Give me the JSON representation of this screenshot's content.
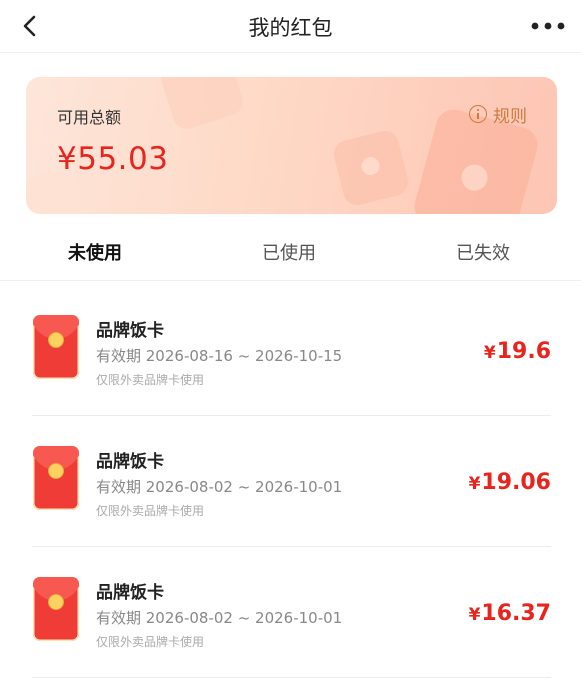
{
  "header": {
    "title": "我的红包"
  },
  "summary": {
    "label": "可用总额",
    "amount": "¥55.03",
    "rules_label": "规则"
  },
  "tabs": [
    {
      "label": "未使用",
      "active": true
    },
    {
      "label": "已使用",
      "active": false
    },
    {
      "label": "已失效",
      "active": false
    }
  ],
  "items": [
    {
      "title": "品牌饭卡",
      "validity": "有效期 2026-08-16 ~ 2026-10-15",
      "note": "仅限外卖品牌卡使用",
      "currency": "¥",
      "amount": "19.6"
    },
    {
      "title": "品牌饭卡",
      "validity": "有效期 2026-08-02 ~ 2026-10-01",
      "note": "仅限外卖品牌卡使用",
      "currency": "¥",
      "amount": "19.06"
    },
    {
      "title": "品牌饭卡",
      "validity": "有效期 2026-08-02 ~ 2026-10-01",
      "note": "仅限外卖品牌卡使用",
      "currency": "¥",
      "amount": "16.37"
    }
  ],
  "icons": {
    "back": "chevron-left-icon",
    "more": "more-horizontal-icon",
    "rules": "info-circle-icon",
    "item": "red-envelope-icon"
  },
  "colors": {
    "accent_red": "#e8241d",
    "rules_orange": "#cf7a3e",
    "banner_peach": "#fed9c6"
  }
}
